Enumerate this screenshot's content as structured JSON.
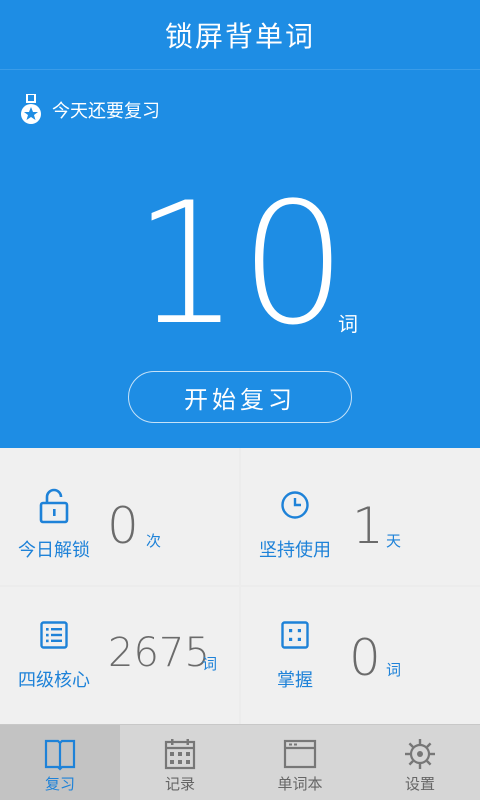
{
  "header": {
    "title": "锁屏背单词",
    "review_label": "今天还要复习",
    "count": "10",
    "count_unit": "词",
    "start_button": "开始复习"
  },
  "stats": [
    {
      "label": "今日解锁",
      "value": "0",
      "unit": "次",
      "icon": "lock-icon"
    },
    {
      "label": "坚持使用",
      "value": "1",
      "unit": "天",
      "icon": "clock-icon"
    },
    {
      "label": "四级核心",
      "value": "2675",
      "unit": "词",
      "icon": "list-icon"
    },
    {
      "label": "掌握",
      "value": "0",
      "unit": "词",
      "icon": "dice-icon"
    }
  ],
  "tabs": [
    {
      "label": "复习",
      "icon": "book-icon",
      "active": true
    },
    {
      "label": "记录",
      "icon": "calendar-icon",
      "active": false
    },
    {
      "label": "单词本",
      "icon": "notebook-icon",
      "active": false
    },
    {
      "label": "设置",
      "icon": "gear-icon",
      "active": false
    }
  ],
  "colors": {
    "primary": "#1e8de4",
    "accent_text": "#1e82d8",
    "value_text": "#6b6b6b",
    "tab_bar": "#d6d6d6",
    "tab_active": "#c3c3c3"
  }
}
